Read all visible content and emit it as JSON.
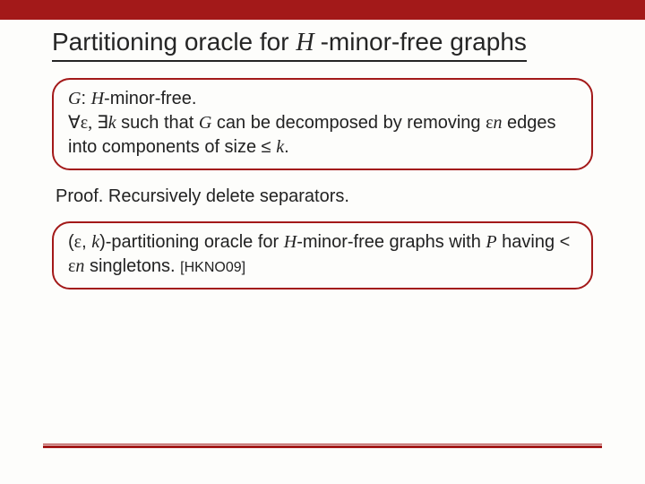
{
  "slide": {
    "title_pre": "Partitioning oracle for ",
    "title_H": "H ",
    "title_post": "-minor-free graphs",
    "box1": {
      "line1_G": "G",
      "line1_colon": ": ",
      "line1_H": "H",
      "line1_rest": "-minor-free.",
      "line2_forall": "∀",
      "line2_eps": "ε, ",
      "line2_exists": "∃",
      "line2_k": "k",
      "line2_mid": " such that ",
      "line2_G": "G",
      "line2_tail": " can be decomposed by removing ",
      "line3_eps": "ε",
      "line3_n": "n",
      "line3_mid": " edges into components of size ≤ ",
      "line3_k": "k",
      "line3_end": "."
    },
    "proof": "Proof. Recursively delete separators.",
    "box2": {
      "open": "(",
      "eps": "ε",
      "comma": ", ",
      "k": "k",
      "seg1": ")-partitioning oracle for ",
      "H": "H",
      "seg2": "-minor-free graphs with ",
      "P": "P",
      "line2a": " having < ",
      "eps2": "ε",
      "n2": "n",
      "line2b": " singletons. ",
      "cite": "[HKNO09]"
    }
  }
}
